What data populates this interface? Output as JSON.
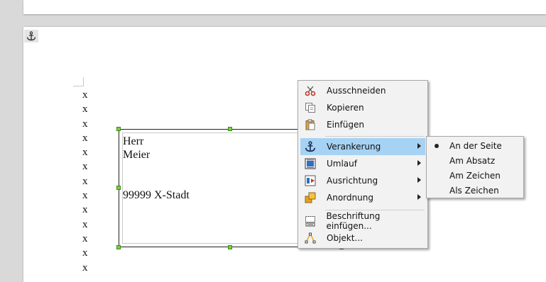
{
  "frame_text": {
    "line1": "Herr",
    "line2": "Meier",
    "line3": "99999 X-Stadt"
  },
  "margin_marks": [
    "x",
    "x",
    "x",
    "x",
    "x",
    "x",
    "x",
    "x",
    "x",
    "x",
    "x",
    "x",
    "x"
  ],
  "context_menu": {
    "items": [
      {
        "label": "Ausschneiden",
        "icon": "scissors-icon"
      },
      {
        "label": "Kopieren",
        "icon": "copy-icon"
      },
      {
        "label": "Einfügen",
        "icon": "paste-icon"
      },
      {
        "label": "Verankerung",
        "icon": "anchor-icon",
        "submenu": true,
        "highlighted": true
      },
      {
        "label": "Umlauf",
        "icon": "wrap-icon",
        "submenu": true
      },
      {
        "label": "Ausrichtung",
        "icon": "align-icon",
        "submenu": true
      },
      {
        "label": "Anordnung",
        "icon": "arrange-icon",
        "submenu": true
      },
      {
        "label": "Beschriftung einfügen...",
        "icon": "caption-icon"
      },
      {
        "label": "Objekt...",
        "icon": "object-icon"
      }
    ]
  },
  "anchor_submenu": {
    "items": [
      {
        "label": "An der Seite",
        "selected": true
      },
      {
        "label": "Am Absatz"
      },
      {
        "label": "Am Zeichen"
      },
      {
        "label": "Als Zeichen"
      }
    ]
  },
  "colors": {
    "highlight": "#a6d2f4",
    "handle": "#7cd03b",
    "menu_bg": "#f2f2f2"
  }
}
